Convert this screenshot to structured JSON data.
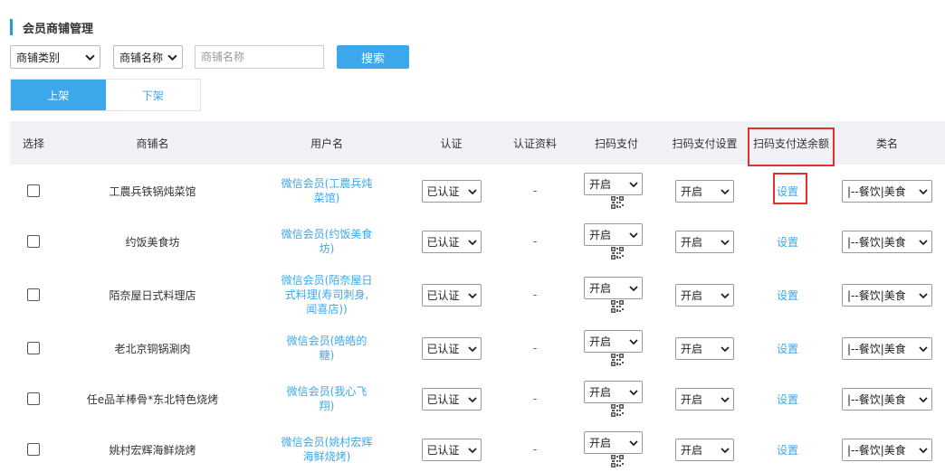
{
  "page": {
    "title": "会员商铺管理"
  },
  "filters": {
    "category_select": "商铺类别",
    "field_select": "商铺名称",
    "keyword_placeholder": "商铺名称",
    "keyword_value": "",
    "search_button": "搜索"
  },
  "tabs": [
    {
      "label": "上架",
      "active": true
    },
    {
      "label": "下架",
      "active": false
    }
  ],
  "table": {
    "headers": [
      "选择",
      "商铺名",
      "用户名",
      "认证",
      "认证资料",
      "扫码支付",
      "扫码支付设置",
      "扫码支付送余额",
      "类名"
    ],
    "rows": [
      {
        "shop": "工農兵铁锅炖菜馆",
        "user": [
          "微信会员(工農兵炖",
          "菜馆)"
        ],
        "auth": "已认证",
        "auth_doc": "-",
        "scan_pay": "开启",
        "scan_setting": "开启",
        "bonus_link": "设置",
        "category": "|--餐饮|美食"
      },
      {
        "shop": "约饭美食坊",
        "user": [
          "微信会员(约饭美食",
          "坊)"
        ],
        "auth": "已认证",
        "auth_doc": "-",
        "scan_pay": "开启",
        "scan_setting": "开启",
        "bonus_link": "设置",
        "category": "|--餐饮|美食"
      },
      {
        "shop": "陌奈屋日式料理店",
        "user": [
          "微信会员(陌奈屋日",
          "式料理(寿司刺身,",
          "闻喜店))"
        ],
        "auth": "已认证",
        "auth_doc": "-",
        "scan_pay": "开启",
        "scan_setting": "开启",
        "bonus_link": "设置",
        "category": "|--餐饮|美食"
      },
      {
        "shop": "老北京铜锅涮肉",
        "user": [
          "微信会员(皓皓的",
          "糖)"
        ],
        "auth": "已认证",
        "auth_doc": "-",
        "scan_pay": "开启",
        "scan_setting": "开启",
        "bonus_link": "设置",
        "category": "|--餐饮|美食"
      },
      {
        "shop": "任e品羊棒骨*东北特色烧烤",
        "user": [
          "微信会员(我心飞",
          "翔)"
        ],
        "auth": "已认证",
        "auth_doc": "-",
        "scan_pay": "开启",
        "scan_setting": "开启",
        "bonus_link": "设置",
        "category": "|--餐饮|美食"
      },
      {
        "shop": "姚村宏辉海鲜烧烤",
        "user": [
          "微信会员(姚村宏辉",
          "海鲜烧烤)"
        ],
        "auth": "已认证",
        "auth_doc": "-",
        "scan_pay": "开启",
        "scan_setting": "开启",
        "bonus_link": "设置",
        "category": "|--餐饮|美食"
      }
    ]
  },
  "colors": {
    "accent": "#3ba8ec",
    "highlight": "#e03030",
    "header_bg": "#f0f2f5"
  },
  "icons": {
    "dropdown": "chevron-down-icon",
    "qrcode": "qr-code-icon"
  }
}
